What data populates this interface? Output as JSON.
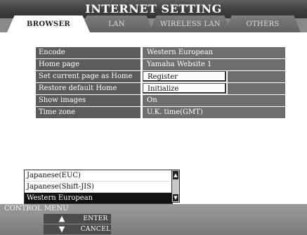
{
  "window": {
    "title": "INTERNET SETTING"
  },
  "tabs": [
    {
      "label": "BROWSER",
      "active": true
    },
    {
      "label": "LAN",
      "active": false
    },
    {
      "label": "WIRELESS LAN",
      "active": false
    },
    {
      "label": "OTHERS",
      "active": false
    }
  ],
  "settings": [
    {
      "label": "Encode",
      "value": "Western European",
      "kind": "value"
    },
    {
      "label": "Home page",
      "value": "Yamaha Website 1",
      "kind": "value"
    },
    {
      "label": "Set current page as Home",
      "value": "Register",
      "kind": "button"
    },
    {
      "label": "Restore default Home",
      "value": "Initialize",
      "kind": "button"
    },
    {
      "label": "Show images",
      "value": "On",
      "kind": "value"
    },
    {
      "label": "Time zone",
      "value": "U.K. time(GMT)",
      "kind": "value"
    }
  ],
  "encode_list": {
    "options": [
      "Japanese(EUC)",
      "Japanese(Shift-JIS)",
      "Western European"
    ],
    "selected": "Western European"
  },
  "control_menu": {
    "label": "CONTROL MENU",
    "up_arrow": "▲",
    "down_arrow": "▼",
    "enter": "ENTER",
    "cancel": "CANCEL"
  },
  "icons": {
    "up": "up-arrow-icon",
    "down": "down-arrow-icon"
  },
  "colors": {
    "title_bar": "#3e3e3e",
    "selected_option": "#111111",
    "row_label_bg": "#5c5c5c"
  }
}
